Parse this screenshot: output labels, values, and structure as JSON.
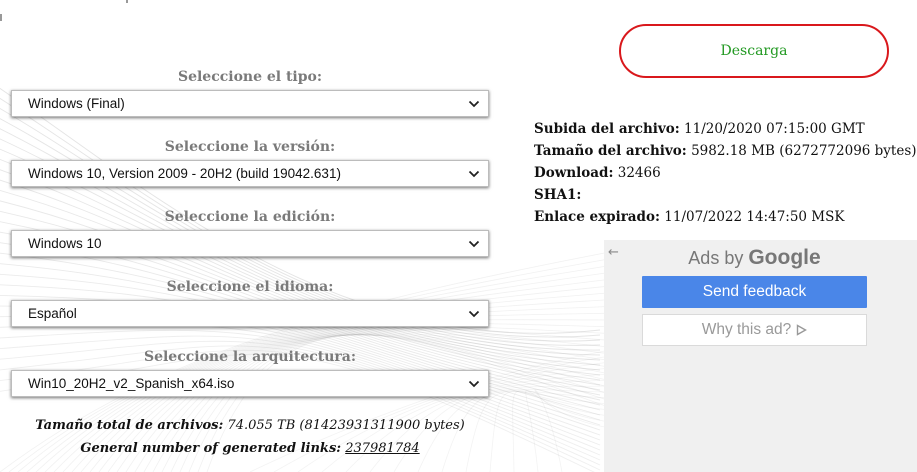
{
  "colors": {
    "download_border": "#d9181c",
    "download_text": "#229922",
    "label_grey": "#7a7a7a",
    "feedback_blue": "#4a86e8",
    "ad_panel_bg": "#f0f0f0"
  },
  "selectors": [
    {
      "label": "Seleccione el tipo:",
      "value": "Windows (Final)"
    },
    {
      "label": "Seleccione la versión:",
      "value": "Windows 10, Version 2009 - 20H2 (build 19042.631)"
    },
    {
      "label": "Seleccione la edición:",
      "value": "Windows 10"
    },
    {
      "label": "Seleccione el idioma:",
      "value": "Español"
    },
    {
      "label": "Seleccione la arquitectura:",
      "value": "Win10_20H2_v2_Spanish_x64.iso"
    }
  ],
  "totals": {
    "size_label": "Tamaño total de archivos:",
    "size_value": "74.055 TB (81423931311900 bytes)",
    "links_label": "General number of generated links:",
    "links_value": "237981784"
  },
  "download_button": {
    "label": "Descarga"
  },
  "file_info": {
    "uploaded_label": "Subida del archivo:",
    "uploaded_value": "11/20/2020 07:15:00 GMT",
    "size_label": "Tamaño del archivo:",
    "size_value": "5982.18 MB (6272772096 bytes)",
    "download_label": "Download:",
    "download_value": "32466",
    "sha1_label": "SHA1:",
    "sha1_value": "",
    "expired_label": "Enlace expirado:",
    "expired_value": "11/07/2022 14:47:50 MSK"
  },
  "ad": {
    "back_arrow": "←",
    "ads_by": "Ads by",
    "google": "Google",
    "send_feedback": "Send feedback",
    "why_this_ad": "Why this ad?",
    "icons": [
      "back-arrow-icon",
      "chevron-down-icon",
      "adchoices-play-icon"
    ]
  }
}
